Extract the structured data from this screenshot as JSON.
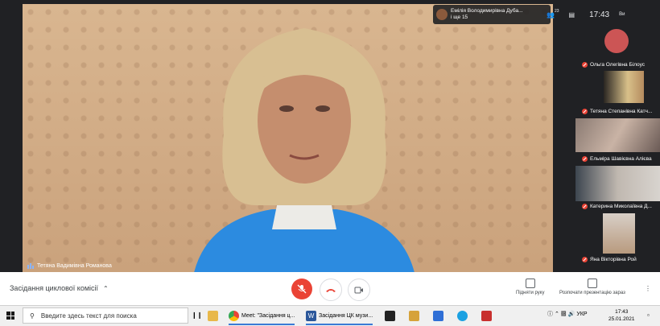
{
  "meeting": {
    "speaker_name": "Тетяна Вадимівна Романова",
    "title": "Засідання циклової комісії",
    "presenter": "Емілія Володимирівна Дуба...",
    "presenter_more": "і ще 15",
    "participant_count": "23",
    "time": "17:43",
    "self_label": "Ви"
  },
  "participants": [
    {
      "name": "Ольга Олегівна Білоус",
      "muted": true
    },
    {
      "name": "Тетяна Степанівна Катч...",
      "muted": true
    },
    {
      "name": "Ельміра Шавієвна Алієва",
      "muted": true
    },
    {
      "name": "Катерина Миколаївна Д...",
      "muted": true
    },
    {
      "name": "Яна Вікторівна Рой",
      "muted": true
    }
  ],
  "actions": {
    "raise_hand": "Підняти руку",
    "present": "Розпочати презентацію зараз"
  },
  "taskbar": {
    "search_placeholder": "Введите здесь текст для поиска",
    "app_chrome": "Meet: \"Засідання ц...",
    "app_word": "Засідання ЦК музи...",
    "lang": "УКР",
    "clock_time": "17:43",
    "clock_date": "25.01.2021"
  },
  "colors": {
    "accent_red": "#ea4335",
    "meet_dark": "#202124"
  }
}
